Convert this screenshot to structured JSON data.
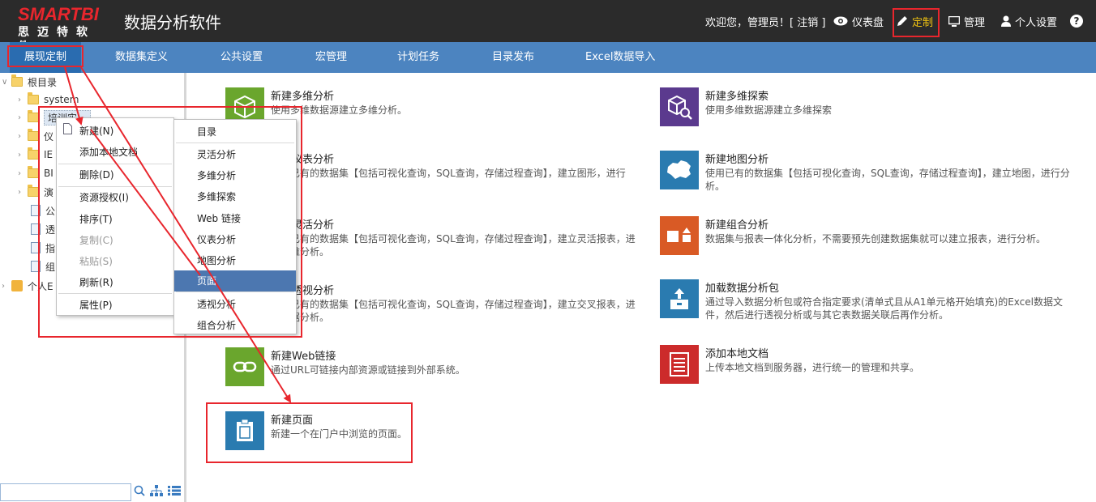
{
  "header": {
    "logo_main": "SMARTBI",
    "logo_sub": "思迈特软件",
    "app_title": "数据分析软件",
    "welcome": "欢迎您，管理员！[ 注销 ]",
    "dashboard": "仪表盘",
    "customize": "定制",
    "manage": "管理",
    "personal": "个人设置",
    "help_icon": "?"
  },
  "nav": {
    "items": [
      "展现定制",
      "数据集定义",
      "公共设置",
      "宏管理",
      "计划任务",
      "目录发布",
      "Excel数据导入"
    ]
  },
  "tree": {
    "root": "根目录",
    "items": [
      "system",
      "培训实…",
      "仪",
      "IE",
      "BI",
      "演",
      "公",
      "透",
      "指",
      "组"
    ],
    "personal": "个人E"
  },
  "context_menu": {
    "items": [
      "新建(N)",
      "添加本地文档",
      "删除(D)",
      "资源授权(I)",
      "排序(T)",
      "复制(C)",
      "粘贴(S)",
      "刷新(R)",
      "属性(P)"
    ]
  },
  "submenu": {
    "items": [
      "目录",
      "灵活分析",
      "多维分析",
      "多维探索",
      "Web 链接",
      "仪表分析",
      "地图分析",
      "页面",
      "透视分析",
      "组合分析"
    ]
  },
  "cards": [
    {
      "title": "新建多维分析",
      "desc": "使用多维数据源建立多维分析。",
      "color": "#6aa62d",
      "icon": "cube-icon"
    },
    {
      "title": "新建多维探索",
      "desc": "使用多维数据源建立多维探索",
      "color": "#5b3a8e",
      "icon": "cube-search-icon"
    },
    {
      "title": "新建仪表分析",
      "desc": "使用已有的数据集【包括可视化查询，SQL查询，存储过程查询】，建立图形，进行",
      "color": "#6aa62d",
      "icon": "gauge-icon"
    },
    {
      "title": "新建地图分析",
      "desc": "使用已有的数据集【包括可视化查询，SQL查询，存储过程查询】，建立地图，进行分析。",
      "color": "#2a7bb0",
      "icon": "map-icon"
    },
    {
      "title": "新建灵活分析",
      "desc": "使用已有的数据集【包括可视化查询，SQL查询，存储过程查询】，建立灵活报表，进行多维分析。",
      "color": "#6aa62d",
      "icon": "table-icon"
    },
    {
      "title": "新建组合分析",
      "desc": "数据集与报表一体化分析，不需要预先创建数据集就可以建立报表，进行分析。",
      "color": "#d95a25",
      "icon": "shapes-icon"
    },
    {
      "title": "新建透视分析",
      "desc": "使用已有的数据集【包括可视化查询，SQL查询，存储过程查询】，建立交叉报表，进行数据分析。",
      "color": "#6aa62d",
      "icon": "pivot-icon"
    },
    {
      "title": "加载数据分析包",
      "desc": "通过导入数据分析包或符合指定要求(清单式且从A1单元格开始填充)的Excel数据文件，然后进行透视分析或与其它表数据关联后再作分析。",
      "color": "#2a7bb0",
      "icon": "upload-box-icon"
    },
    {
      "title": "新建Web链接",
      "desc": "通过URL可链接内部资源或链接到外部系统。",
      "color": "#6aa62d",
      "icon": "link-icon"
    },
    {
      "title": "添加本地文档",
      "desc": "上传本地文档到服务器，进行统一的管理和共享。",
      "color": "#cc2b2b",
      "icon": "document-icon"
    },
    {
      "title": "新建页面",
      "desc": "新建一个在门户中浏览的页面。",
      "color": "#2a7bb0",
      "icon": "page-icon"
    }
  ]
}
